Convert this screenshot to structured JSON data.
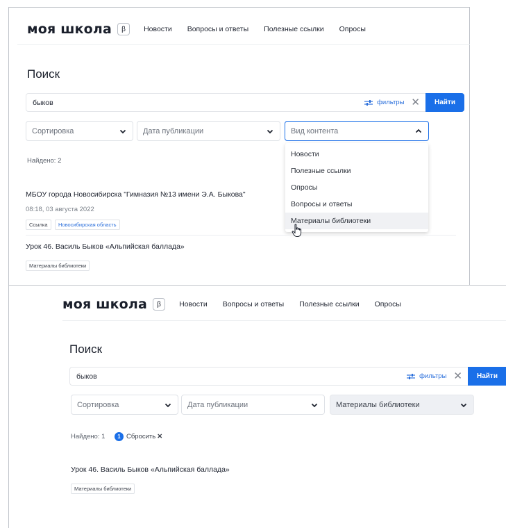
{
  "top": {
    "logo": "моя школа",
    "beta": "β",
    "nav": [
      "Новости",
      "Вопросы и ответы",
      "Полезные ссылки",
      "Опросы"
    ],
    "heading": "Поиск",
    "search_value": "быков",
    "filters_label": "фильтры",
    "find_label": "Найти",
    "sort_label": "Сортировка",
    "date_label": "Дата публикации",
    "content_label": "Вид контента",
    "dropdown_items": [
      "Новости",
      "Полезные ссылки",
      "Опросы",
      "Вопросы и ответы",
      "Материалы библиотеки"
    ],
    "found": "Найдено: 2",
    "results": [
      {
        "title": "МБОУ города Новосибирска \"Гимназия №13 имени Э.А. Быкова\"",
        "date": "08:18, 03 августа 2022",
        "tags": [
          "Ссылка",
          "Новосибирская область"
        ]
      },
      {
        "title": "Урок 46. Василь Быков «Альпийская баллада»",
        "tags": [
          "Материалы библиотеки"
        ]
      }
    ]
  },
  "bottom": {
    "logo": "моя школа",
    "beta": "β",
    "nav": [
      "Новости",
      "Вопросы и ответы",
      "Полезные ссылки",
      "Опросы"
    ],
    "heading": "Поиск",
    "search_value": "быков",
    "filters_label": "фильтры",
    "find_label": "Найти",
    "sort_label": "Сортировка",
    "date_label": "Дата публикации",
    "content_value": "Материалы библиотеки",
    "found": "Найдено: 1",
    "reset_count": "1",
    "reset_label": "Сбросить",
    "results": [
      {
        "title": "Урок 46. Василь Быков «Альпийская баллада»",
        "tags": [
          "Материалы библиотеки"
        ]
      }
    ]
  },
  "colors": {
    "accent": "#1a6fe8",
    "link": "#2a6fdb"
  }
}
